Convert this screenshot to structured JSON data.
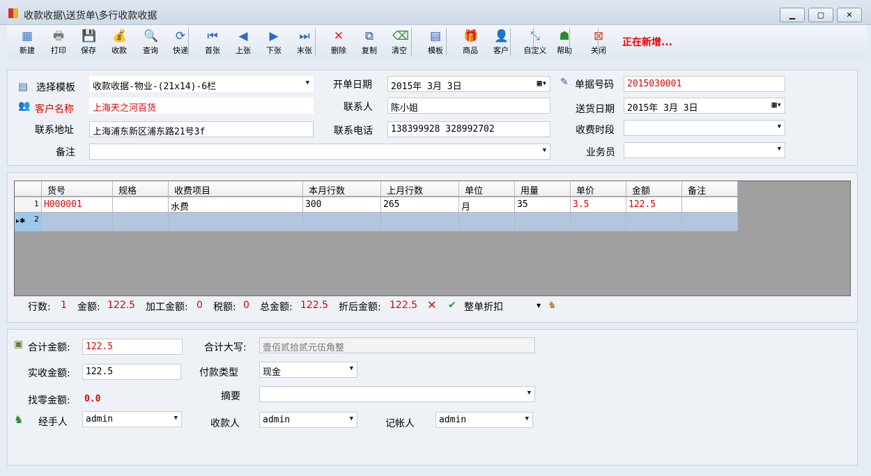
{
  "window": {
    "title": "收款收据\\送货单\\多行收款收据",
    "minimize": "▁",
    "maximize": "▢",
    "close": "✕"
  },
  "toolbar": {
    "buttons": [
      {
        "label": "新建",
        "icon": "grid-icon",
        "glyph": "▦",
        "color": "#3a78c8"
      },
      {
        "label": "打印",
        "icon": "printer-icon",
        "glyph": "🖶",
        "color": "#777"
      },
      {
        "label": "保存",
        "icon": "floppy-icon",
        "glyph": "💾",
        "color": "#2a5aa8"
      },
      {
        "label": "收款",
        "icon": "money-bag-icon",
        "glyph": "💰",
        "color": "#c8901a"
      },
      {
        "label": "查询",
        "icon": "search-icon",
        "glyph": "🔍",
        "color": "#666"
      },
      {
        "label": "快递",
        "icon": "refresh-icon",
        "glyph": "⟳",
        "color": "#2a6ac8"
      },
      {
        "label": "首张",
        "icon": "first-icon",
        "glyph": "⏮",
        "color": "#2a6ac8"
      },
      {
        "label": "上张",
        "icon": "prev-icon",
        "glyph": "◀",
        "color": "#2a6ac8"
      },
      {
        "label": "下张",
        "icon": "next-icon",
        "glyph": "▶",
        "color": "#2a6ac8"
      },
      {
        "label": "末张",
        "icon": "last-icon",
        "glyph": "⏭",
        "color": "#2a6ac8"
      },
      {
        "label": "删除",
        "icon": "delete-icon",
        "glyph": "✕",
        "color": "#d22"
      },
      {
        "label": "复制",
        "icon": "copy-icon",
        "glyph": "⧉",
        "color": "#2a5aa8"
      },
      {
        "label": "清空",
        "icon": "clear-icon",
        "glyph": "⌫",
        "color": "#2a8a2a"
      },
      {
        "label": "模板",
        "icon": "template-icon",
        "glyph": "▤",
        "color": "#2a5aa8"
      },
      {
        "label": "商品",
        "icon": "gift-icon",
        "glyph": "🎁",
        "color": "#2a9a4a"
      },
      {
        "label": "客户",
        "icon": "user-icon",
        "glyph": "👤",
        "color": "#5a9ad8"
      },
      {
        "label": "自定义",
        "icon": "custom-icon",
        "glyph": "⤡",
        "color": "#2a8ac8"
      },
      {
        "label": "帮助",
        "icon": "help-icon",
        "glyph": "☗",
        "color": "#2a8a2a"
      },
      {
        "label": "关闭",
        "icon": "close-icon",
        "glyph": "⊠",
        "color": "#e04010"
      }
    ],
    "status": "正在新增..."
  },
  "form": {
    "template_label": "选择模板",
    "template_value": "收款收据-物业-(21x14)-6栏",
    "open_date_label": "开单日期",
    "open_date_value": "2015年  3月  3日",
    "doc_no_label": "单据号码",
    "doc_no_value": "2015030001",
    "customer_label": "客户名称",
    "customer_value": "上海天之河百货",
    "contact_label": "联系人",
    "contact_value": "陈小姐",
    "delivery_date_label": "送货日期",
    "delivery_date_value": "2015年  3月  3日",
    "address_label": "联系地址",
    "address_value": "上海浦东新区浦东路21号3f",
    "phone_label": "联系电话",
    "phone_value": "138399928 328992702",
    "period_label": "收费时段",
    "period_value": "",
    "remark_label": "备注",
    "remark_value": "",
    "salesman_label": "业务员",
    "salesman_value": ""
  },
  "grid": {
    "columns": [
      "货号",
      "规格",
      "收费项目",
      "本月行数",
      "上月行数",
      "单位",
      "用量",
      "单价",
      "金额",
      "备注"
    ],
    "rows": [
      {
        "num": "1",
        "cells": [
          "H000001",
          "",
          "水费",
          "300",
          "265",
          "月",
          "35",
          "3.5",
          "122.5",
          ""
        ]
      },
      {
        "num": "2",
        "cells": [
          "",
          "",
          "",
          "",
          "",
          "",
          "",
          "",
          "",
          ""
        ]
      }
    ]
  },
  "summary": {
    "rows_label": "行数:",
    "rows": "1",
    "amount_label": "金额:",
    "amount": "122.5",
    "proc_label": "加工金额:",
    "proc": "0",
    "tax_label": "税额:",
    "tax": "0",
    "total_label": "总金额:",
    "total": "122.5",
    "disc_label": "折后金额:",
    "disc": "122.5",
    "whole_discount": "整单折扣"
  },
  "bottom": {
    "sum_label": "合计金额:",
    "sum_value": "122.5",
    "upper_label": "合计大写:",
    "upper_value": "壹佰贰拾贰元伍角整",
    "received_label": "实收金额:",
    "received_value": "122.5",
    "paytype_label": "付款类型",
    "paytype_value": "现金",
    "change_label": "找零金额:",
    "change_value": "0.0",
    "summary_label": "摘要",
    "summary_value": "",
    "handler_label": "经手人",
    "handler_value": "admin",
    "payee_label": "收款人",
    "payee_value": "admin",
    "bookkeeper_label": "记帐人",
    "bookkeeper_value": "admin"
  }
}
